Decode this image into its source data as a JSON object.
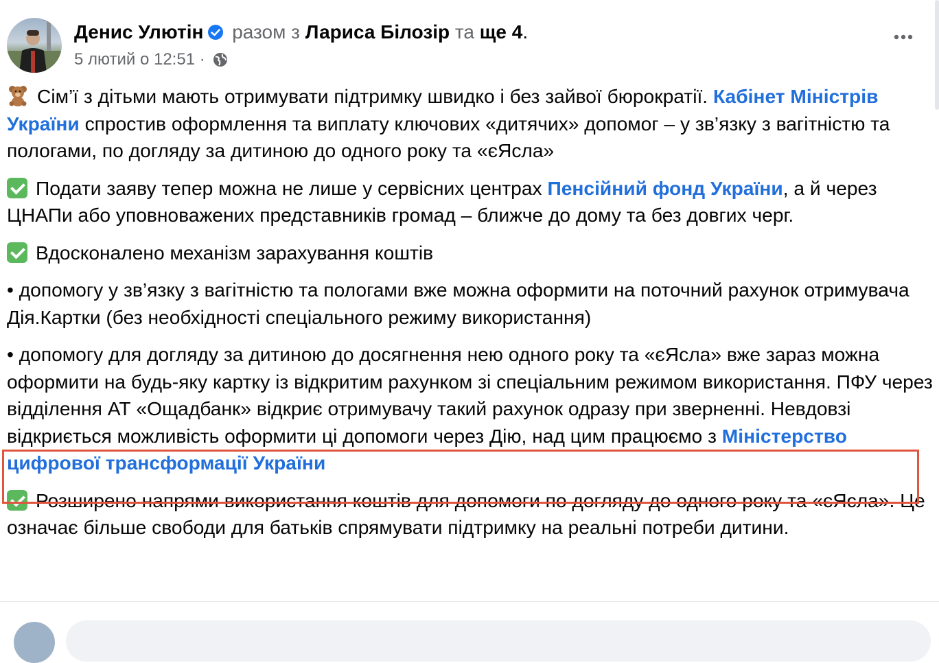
{
  "post": {
    "author": "Денис Улютін",
    "with_word": "разом з",
    "tagged": "Лариса Білозір",
    "and_word": "та",
    "others": "ще 4",
    "period": ".",
    "date": "5 лютий о 12:51",
    "separator": "·",
    "audience_icon": "globe-icon"
  },
  "content": {
    "p1_text": "Сім’ї з дітьми мають отримувати підтримку швидко і без зайвої бюрократії. ",
    "p1_link": "Кабінет Міністрів України",
    "p1_rest": " спростив оформлення та виплату ключових «дитячих» допомог – у зв’язку з вагітністю та пологами, по догляду за дитиною до одного року та «єЯсла»",
    "p2_text": "Подати заяву тепер можна не лише у сервісних центрах ",
    "p2_link": "Пенсійний фонд України",
    "p2_rest": ", а й через ЦНАПи або уповноважених представників громад – ближче до дому та без довгих черг.",
    "p3_text": "Вдосконалено механізм зарахування коштів",
    "p4_text": "• допомогу у зв’язку з вагітністю та пологами вже можна оформити на поточний рахунок отримувача Дія.Картки (без необхідності спеціального режиму використання)",
    "p5_text": "• допомогу для догляду за дитиною до досягнення нею одного року та «єЯсла» вже зараз можна оформити на будь-яку картку із відкритим рахунком зі спеціальним режимом використання. ПФУ через відділення АТ «Ощадбанк» відкриє отримувачу такий рахунок одразу при зверненні. Невдовзі відкриється можливість оформити ці допомоги через Дію, над цим працюємо з ",
    "p5_link": "Міністерство цифрової трансформації України",
    "p6_text": "Розширено напрями використання коштів для допомоги по догляду до одного року та «єЯсла». Це означає більше свободи для батьків спрямувати підтримку на реальні потреби дитини."
  },
  "icons": {
    "verified": "verified-badge-icon",
    "more": "more-options-icon",
    "bear": "teddy-bear-emoji",
    "check": "check-mark-emoji"
  },
  "colors": {
    "link": "#216fdb",
    "muted": "#65676b",
    "highlight_border": "#e0553e",
    "verified": "#1877f2",
    "check_green": "#5cb85c"
  }
}
